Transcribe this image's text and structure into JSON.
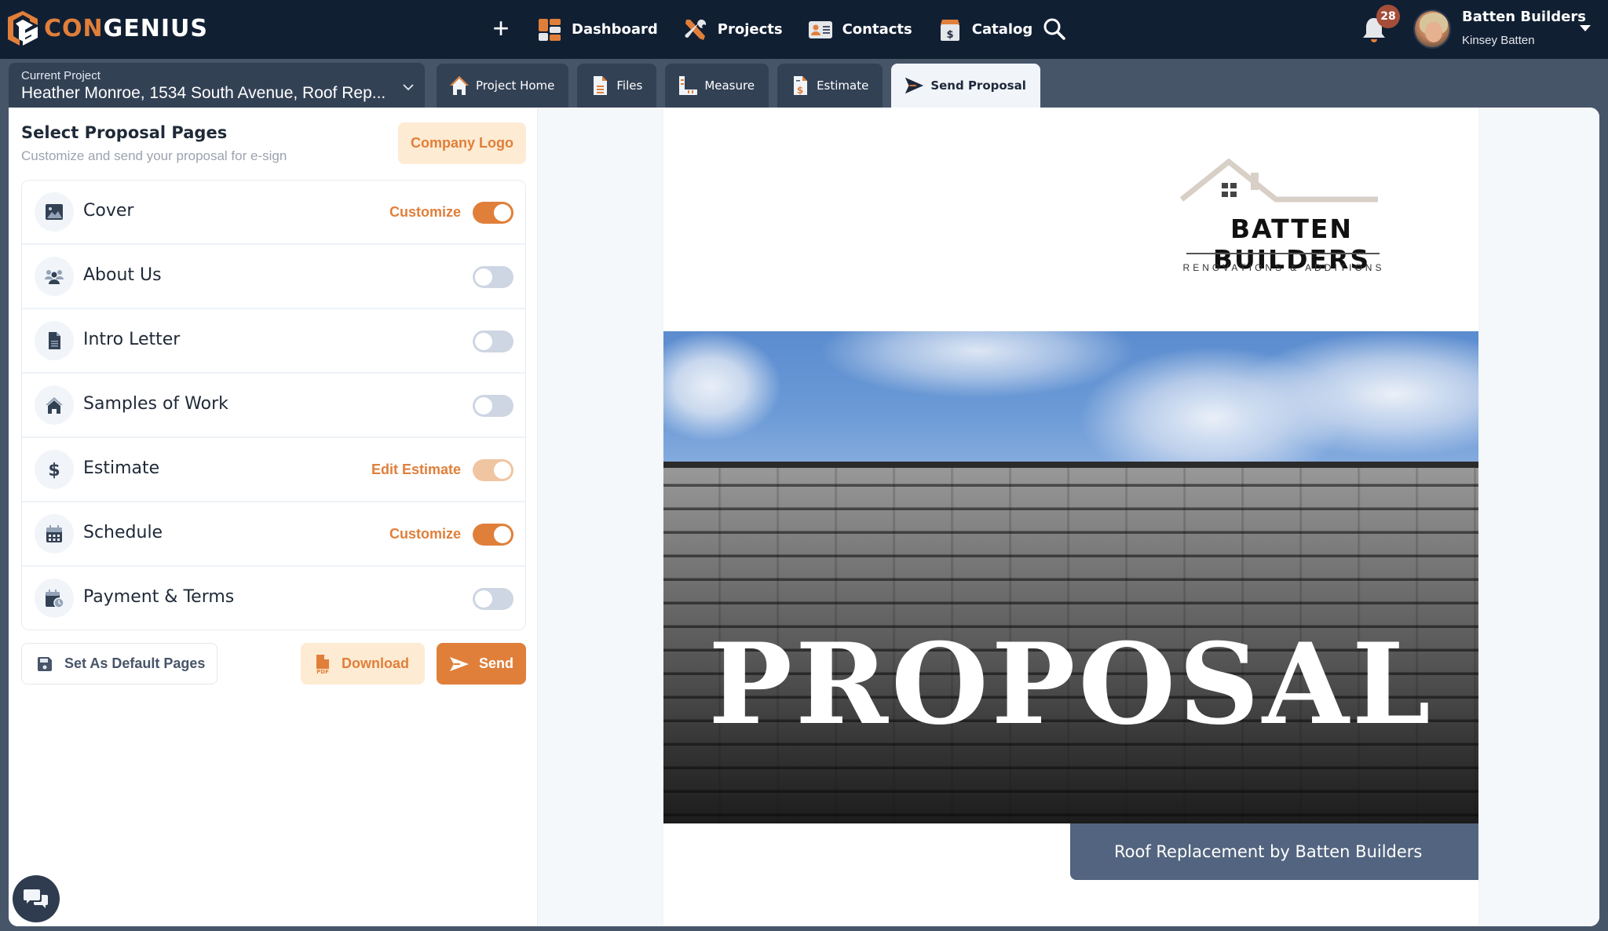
{
  "app": {
    "brand_prefix": "CON",
    "brand_suffix": "GENIUS",
    "accent_color": "#e07f3a",
    "nav_bg_color": "#111f33"
  },
  "nav": {
    "add_icon": "plus-icon",
    "items": [
      {
        "label": "Dashboard",
        "icon": "dashboard-icon"
      },
      {
        "label": "Projects",
        "icon": "tools-icon"
      },
      {
        "label": "Contacts",
        "icon": "contact-card-icon"
      },
      {
        "label": "Catalog",
        "icon": "catalog-box-icon"
      }
    ],
    "search_icon": "search-icon",
    "notifications_count": "28",
    "user": {
      "company": "Batten Builders",
      "name": "Kinsey Batten"
    }
  },
  "project": {
    "label": "Current Project",
    "value": "Heather Monroe, 1534 South Avenue, Roof Rep..."
  },
  "tabs": [
    {
      "label": "Project Home",
      "icon": "home-icon",
      "active": false
    },
    {
      "label": "Files",
      "icon": "file-icon",
      "active": false
    },
    {
      "label": "Measure",
      "icon": "ruler-icon",
      "active": false
    },
    {
      "label": "Estimate",
      "icon": "estimate-icon",
      "active": false
    },
    {
      "label": "Send Proposal",
      "icon": "send-icon",
      "active": true
    }
  ],
  "panel": {
    "title": "Select Proposal Pages",
    "subtitle": "Customize and send your proposal for e-sign",
    "company_logo_button": "Company Logo",
    "pages": [
      {
        "label": "Cover",
        "icon": "image-icon",
        "action": "Customize",
        "enabled": true
      },
      {
        "label": "About Us",
        "icon": "users-icon",
        "action": "",
        "enabled": false
      },
      {
        "label": "Intro Letter",
        "icon": "document-icon",
        "action": "",
        "enabled": false
      },
      {
        "label": "Samples of Work",
        "icon": "house-icon",
        "action": "",
        "enabled": false
      },
      {
        "label": "Estimate",
        "icon": "dollar-icon",
        "action": "Edit Estimate",
        "enabled": true,
        "locked": true
      },
      {
        "label": "Schedule",
        "icon": "calendar-icon",
        "action": "Customize",
        "enabled": true
      },
      {
        "label": "Payment & Terms",
        "icon": "calendar-clock-icon",
        "action": "",
        "enabled": false
      }
    ],
    "buttons": {
      "set_default": "Set As Default Pages",
      "download": "Download",
      "send": "Send"
    }
  },
  "preview": {
    "brand_name": "BATTEN BUILDERS",
    "brand_tagline": "RENOVATIONS & ADDITIONS",
    "cover_title": "PROPOSAL",
    "cover_footer": "Roof Replacement by Batten Builders"
  }
}
